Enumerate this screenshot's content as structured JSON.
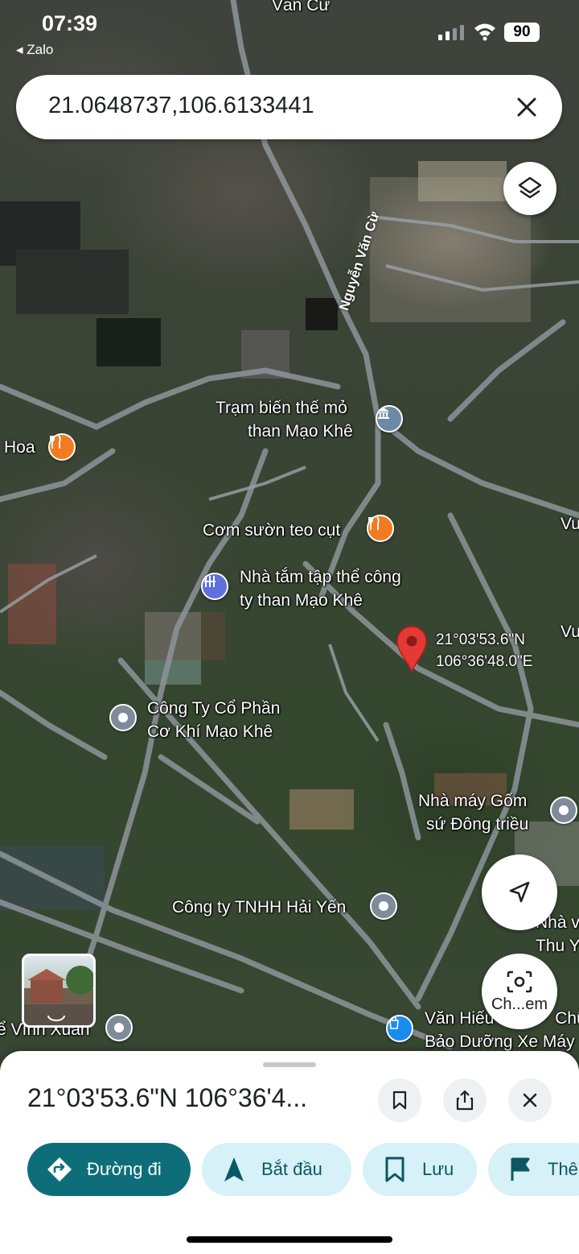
{
  "status_bar": {
    "time": "07:39",
    "back_app": "Zalo",
    "battery": "90"
  },
  "search": {
    "query": "21.0648737,106.6133441"
  },
  "map": {
    "top_street": "Văn Cừ",
    "road_name": "Nguyễn Văn Cừ",
    "places": [
      {
        "name": "Trạm biến thế mỏ",
        "name2": "than Mạo Khê",
        "icon": "government-icon"
      },
      {
        "name": "Hoa",
        "icon": "restaurant-icon"
      },
      {
        "name": "Cơm sườn teo cụt",
        "icon": "restaurant-icon"
      },
      {
        "name": "Nhà tắm tập thể công",
        "name2": "ty than Mạo Khê",
        "icon": "bathhouse-icon"
      },
      {
        "name": "Công Ty Cổ Phần",
        "name2": "Cơ Khí Mạo Khê",
        "icon": "place-icon"
      },
      {
        "name": "Nhà máy Gốm",
        "name2": "sứ Đông triều",
        "icon": "place-icon"
      },
      {
        "name": "Công ty TNHH Hải Yến",
        "icon": "place-icon"
      },
      {
        "name": "Nhà v",
        "name2": "Thu Y",
        "icon": "place-icon"
      },
      {
        "name": "Văn Hiếu",
        "name2": "Bảo Dưỡng Xe Máy",
        "name3": "Chữa",
        "icon": "shopping-icon"
      },
      {
        "name": "ể Vĩnh Xuân",
        "icon": "place-icon"
      },
      {
        "name": "Vu"
      },
      {
        "name": "Vu"
      }
    ],
    "dropped_pin": {
      "lat_dms": "21°03'53.6\"N",
      "lng_dms": "106°36'48.0\"E"
    }
  },
  "buttons": {
    "lens_label": "Ch...em"
  },
  "sheet": {
    "title": "21°03'53.6\"N 106°36'4...",
    "actions": [
      {
        "label": "Đường đi",
        "icon": "directions-icon"
      },
      {
        "label": "Bắt đầu",
        "icon": "navigation-arrow-icon"
      },
      {
        "label": "Lưu",
        "icon": "bookmark-icon"
      },
      {
        "label": "Thê",
        "icon": "flag-icon"
      }
    ]
  },
  "colors": {
    "primary": "#0d6e7a",
    "secondary_chip": "#d6f1f7",
    "pin": "#e53935",
    "food_poi": "#f27b22",
    "spa_poi": "#5e6fe0",
    "shop_poi": "#1a8cf0"
  }
}
